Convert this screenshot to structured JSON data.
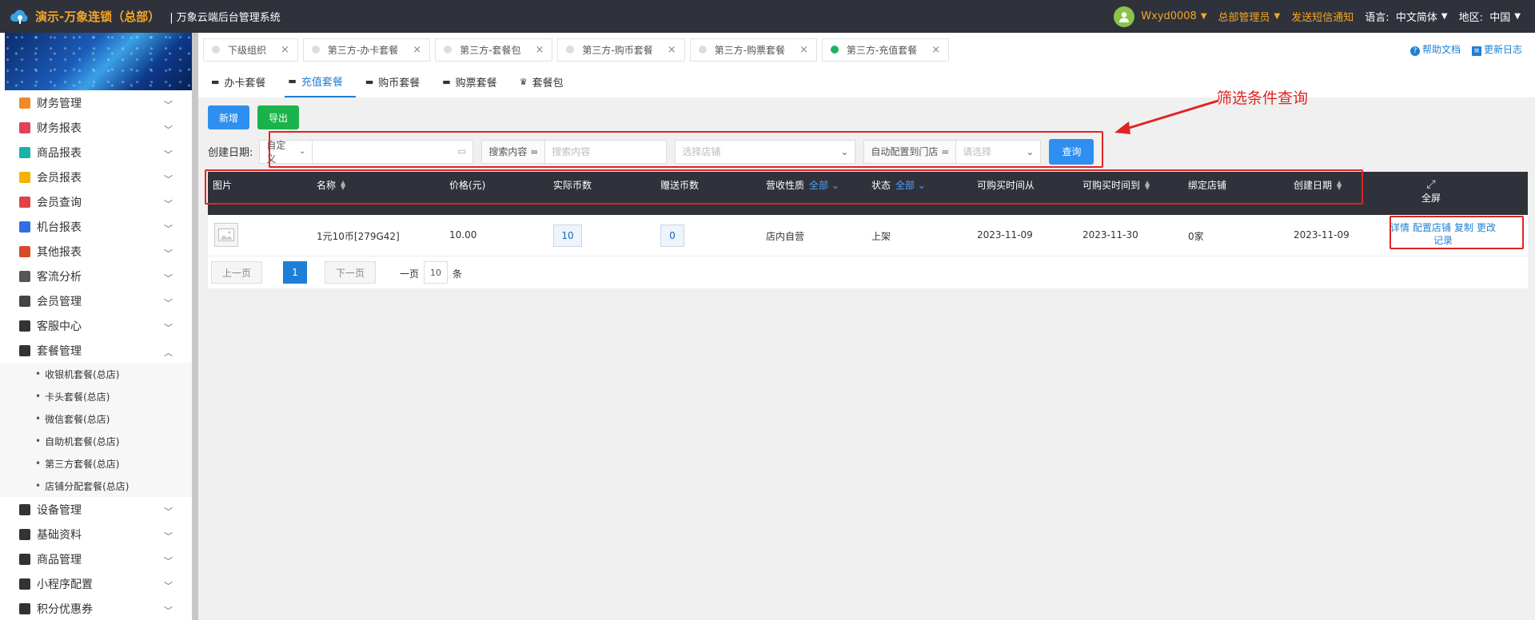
{
  "topbar": {
    "brand": "演示-万象连锁（总部）",
    "subtitle": "| 万象云端后台管理系统",
    "user": "Wxyd0008",
    "role": "总部管理员",
    "sms": "发送短信通知",
    "lang_label": "语言:",
    "lang_value": "中文简体",
    "region_label": "地区:",
    "region_value": "中国"
  },
  "sidebar": {
    "items": [
      {
        "label": "财务管理",
        "color": "#f08a24"
      },
      {
        "label": "财务报表",
        "color": "#e0435b"
      },
      {
        "label": "商品报表",
        "color": "#19b3a6"
      },
      {
        "label": "会员报表",
        "color": "#f5b300"
      },
      {
        "label": "会员查询",
        "color": "#e04343"
      },
      {
        "label": "机台报表",
        "color": "#2f6fe0"
      },
      {
        "label": "其他报表",
        "color": "#d9482b"
      },
      {
        "label": "客流分析",
        "color": "#555555"
      },
      {
        "label": "会员管理",
        "color": "#444444"
      },
      {
        "label": "客服中心",
        "color": "#333333"
      },
      {
        "label": "套餐管理",
        "color": "#333333"
      }
    ],
    "sub_items": [
      "收银机套餐(总店)",
      "卡头套餐(总店)",
      "微信套餐(总店)",
      "自助机套餐(总店)",
      "第三方套餐(总店)",
      "店铺分配套餐(总店)"
    ],
    "items_after": [
      {
        "label": "设备管理",
        "color": "#333333"
      },
      {
        "label": "基础资料",
        "color": "#333333"
      },
      {
        "label": "商品管理",
        "color": "#333333"
      },
      {
        "label": "小程序配置",
        "color": "#333333"
      },
      {
        "label": "积分优惠券",
        "color": "#333333"
      }
    ]
  },
  "tabs": [
    {
      "label": "下级组织",
      "active": false
    },
    {
      "label": "第三方-办卡套餐",
      "active": false
    },
    {
      "label": "第三方-套餐包",
      "active": false
    },
    {
      "label": "第三方-购币套餐",
      "active": false
    },
    {
      "label": "第三方-购票套餐",
      "active": false
    },
    {
      "label": "第三方-充值套餐",
      "active": true
    }
  ],
  "help": {
    "docs": "帮助文档",
    "changelog": "更新日志"
  },
  "subtabs": [
    {
      "label": "办卡套餐",
      "icon": "card-icon",
      "active": false
    },
    {
      "label": "充值套餐",
      "icon": "recharge-icon",
      "active": true
    },
    {
      "label": "购币套餐",
      "icon": "coin-icon",
      "active": false
    },
    {
      "label": "购票套餐",
      "icon": "ticket-icon",
      "active": false
    },
    {
      "label": "套餐包",
      "icon": "bag-icon",
      "active": false
    }
  ],
  "toolbar": {
    "add": "新增",
    "export": "导出"
  },
  "filter": {
    "date_label": "创建日期:",
    "date_mode": "自定义",
    "search_label": "搜索内容 =",
    "search_placeholder": "搜索内容",
    "store_placeholder": "选择店铺",
    "auto_label": "自动配置到门店 =",
    "auto_placeholder": "请选择",
    "query": "查询"
  },
  "table": {
    "headers": {
      "image": "图片",
      "name": "名称",
      "price": "价格(元)",
      "actual_coins": "实际币数",
      "gift_coins": "赠送币数",
      "revenue_type": "营收性质",
      "revenue_filter": "全部",
      "status": "状态",
      "status_filter": "全部",
      "buy_from": "可购买时间从",
      "buy_to": "可购买时间到",
      "bound_store": "绑定店铺",
      "created": "创建日期",
      "fullscreen": "全屏"
    },
    "rows": [
      {
        "name": "1元10币[279G42]",
        "price": "10.00",
        "actual_coins": "10",
        "gift_coins": "0",
        "revenue_type": "店内自营",
        "status": "上架",
        "buy_from": "2023-11-09",
        "buy_to": "2023-11-30",
        "bound_store": "0家",
        "created": "2023-11-09",
        "ops": [
          "详情",
          "配置店铺",
          "复制",
          "更改",
          "记录"
        ]
      }
    ]
  },
  "pager": {
    "prev": "上一页",
    "current": "1",
    "next": "下一页",
    "per_label": "一页",
    "per_value": "10",
    "per_unit": "条"
  },
  "annotation": {
    "text": "筛选条件查询"
  }
}
